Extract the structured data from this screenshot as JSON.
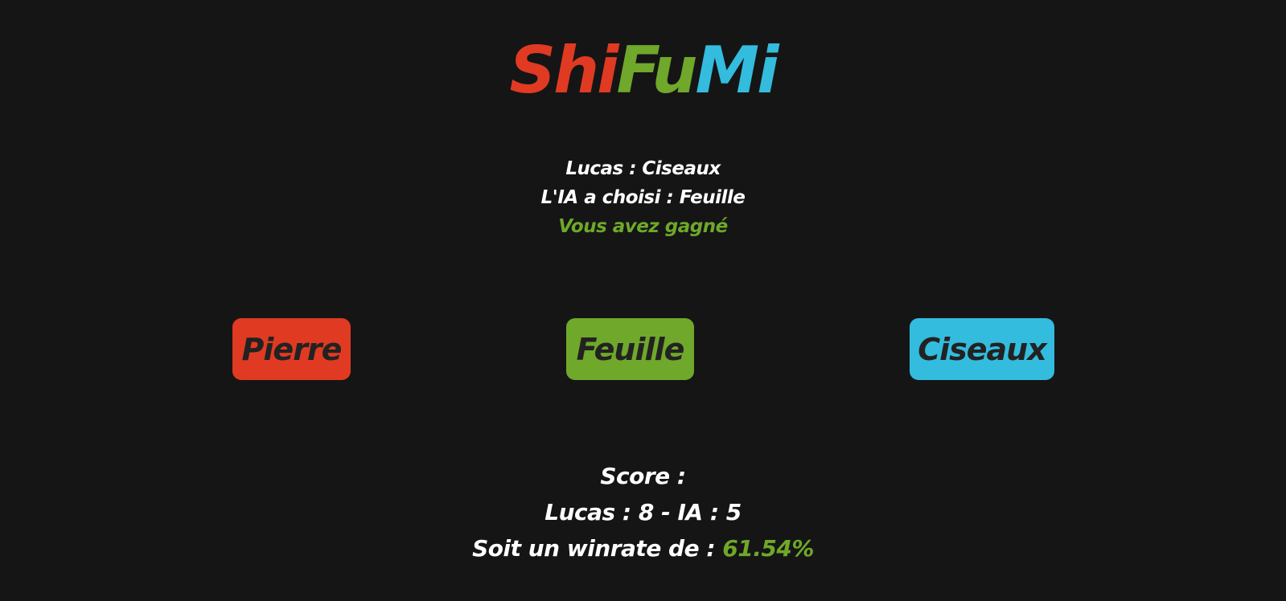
{
  "title": {
    "part1": "Shi",
    "part2": "Fu",
    "part3": "Mi"
  },
  "colors": {
    "red": "#e03a23",
    "green": "#6fa82a",
    "blue": "#33bcdd",
    "background": "#151515",
    "button_text": "#222222"
  },
  "result": {
    "player_choice": "Lucas : Ciseaux",
    "ai_choice": "L'IA a choisi : Feuille",
    "outcome": "Vous avez gagné"
  },
  "buttons": {
    "rock": "Pierre",
    "paper": "Feuille",
    "scissors": "Ciseaux"
  },
  "score": {
    "heading": "Score :",
    "line": "Lucas : 8 - IA : 5",
    "winrate_label": "Soit un winrate de : ",
    "winrate_value": "61.54%"
  }
}
